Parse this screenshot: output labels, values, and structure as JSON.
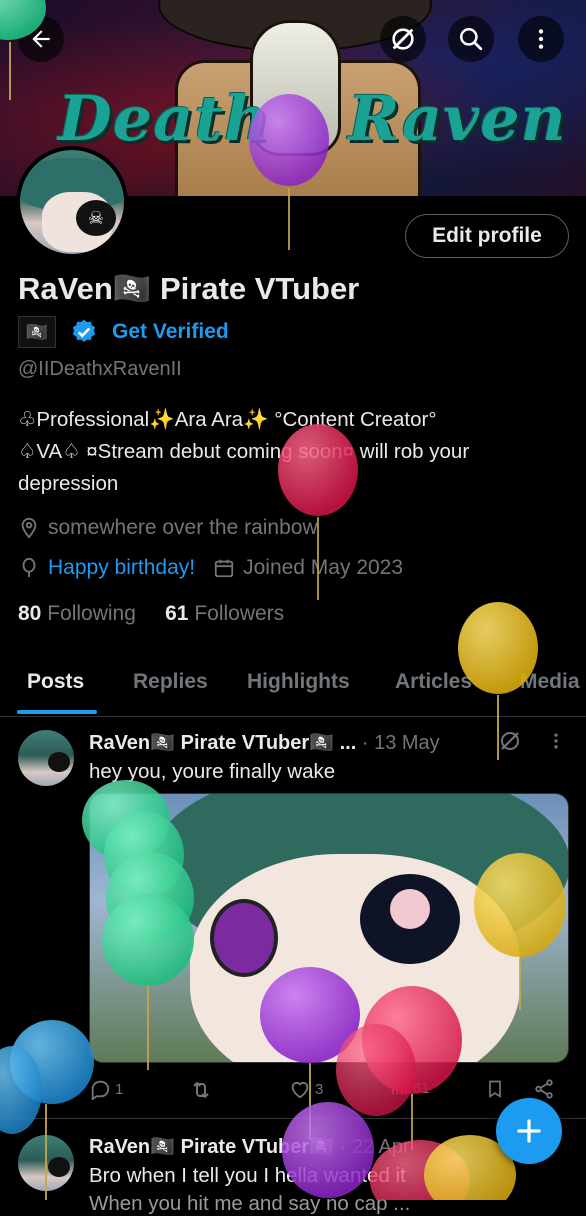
{
  "header": {
    "banner_title_left": "Death",
    "banner_title_right": "Raven",
    "back_icon": "arrow-left-icon",
    "grok_icon": "grok-icon",
    "search_icon": "search-icon",
    "more_icon": "more-vertical-icon"
  },
  "profile": {
    "edit_button": "Edit profile",
    "display_name": "RaVen🏴‍☠️ Pirate VTuber",
    "flag_emoji": "🏴‍☠️",
    "get_verified": "Get Verified",
    "handle": "@IIDeathxRavenII",
    "bio_line1": "♧Professional✨Ara Ara✨ °Content Creator°",
    "bio_line2": "♤VA♤ ¤Stream debut coming soon¤  will rob your",
    "bio_line3": "depression",
    "location": "somewhere over the rainbow",
    "birthday": "Happy birthday!",
    "joined": "Joined May 2023",
    "following_count": "80",
    "following_label": "Following",
    "followers_count": "61",
    "followers_label": "Followers"
  },
  "tabs": [
    {
      "label": "Posts"
    },
    {
      "label": "Replies"
    },
    {
      "label": "Highlights"
    },
    {
      "label": "Articles"
    },
    {
      "label": "Media"
    }
  ],
  "posts": [
    {
      "name": "RaVen🏴‍☠️ Pirate VTuber🏴‍☠️ ...",
      "time": "· 13 May",
      "text": "hey you, youre finally wake",
      "replies": "1",
      "likes": "3",
      "views": "61"
    },
    {
      "name": "RaVen🏴‍☠️ Pirate VTuber🏴‍☠️",
      "time": "· 22 Apr",
      "text": "Bro when I tell you I hella wanted it",
      "text2": "When you hit me and say no cap ..."
    }
  ],
  "colors": {
    "accent": "#1d9bf0",
    "background": "#000000",
    "muted": "#71767b",
    "text": "#e7e9ea",
    "balloon_green": "#2fd08f",
    "balloon_purple": "#9b37d6",
    "balloon_red": "#e3245a",
    "balloon_yellow": "#e6c21d",
    "balloon_blue": "#2a9ad8"
  }
}
